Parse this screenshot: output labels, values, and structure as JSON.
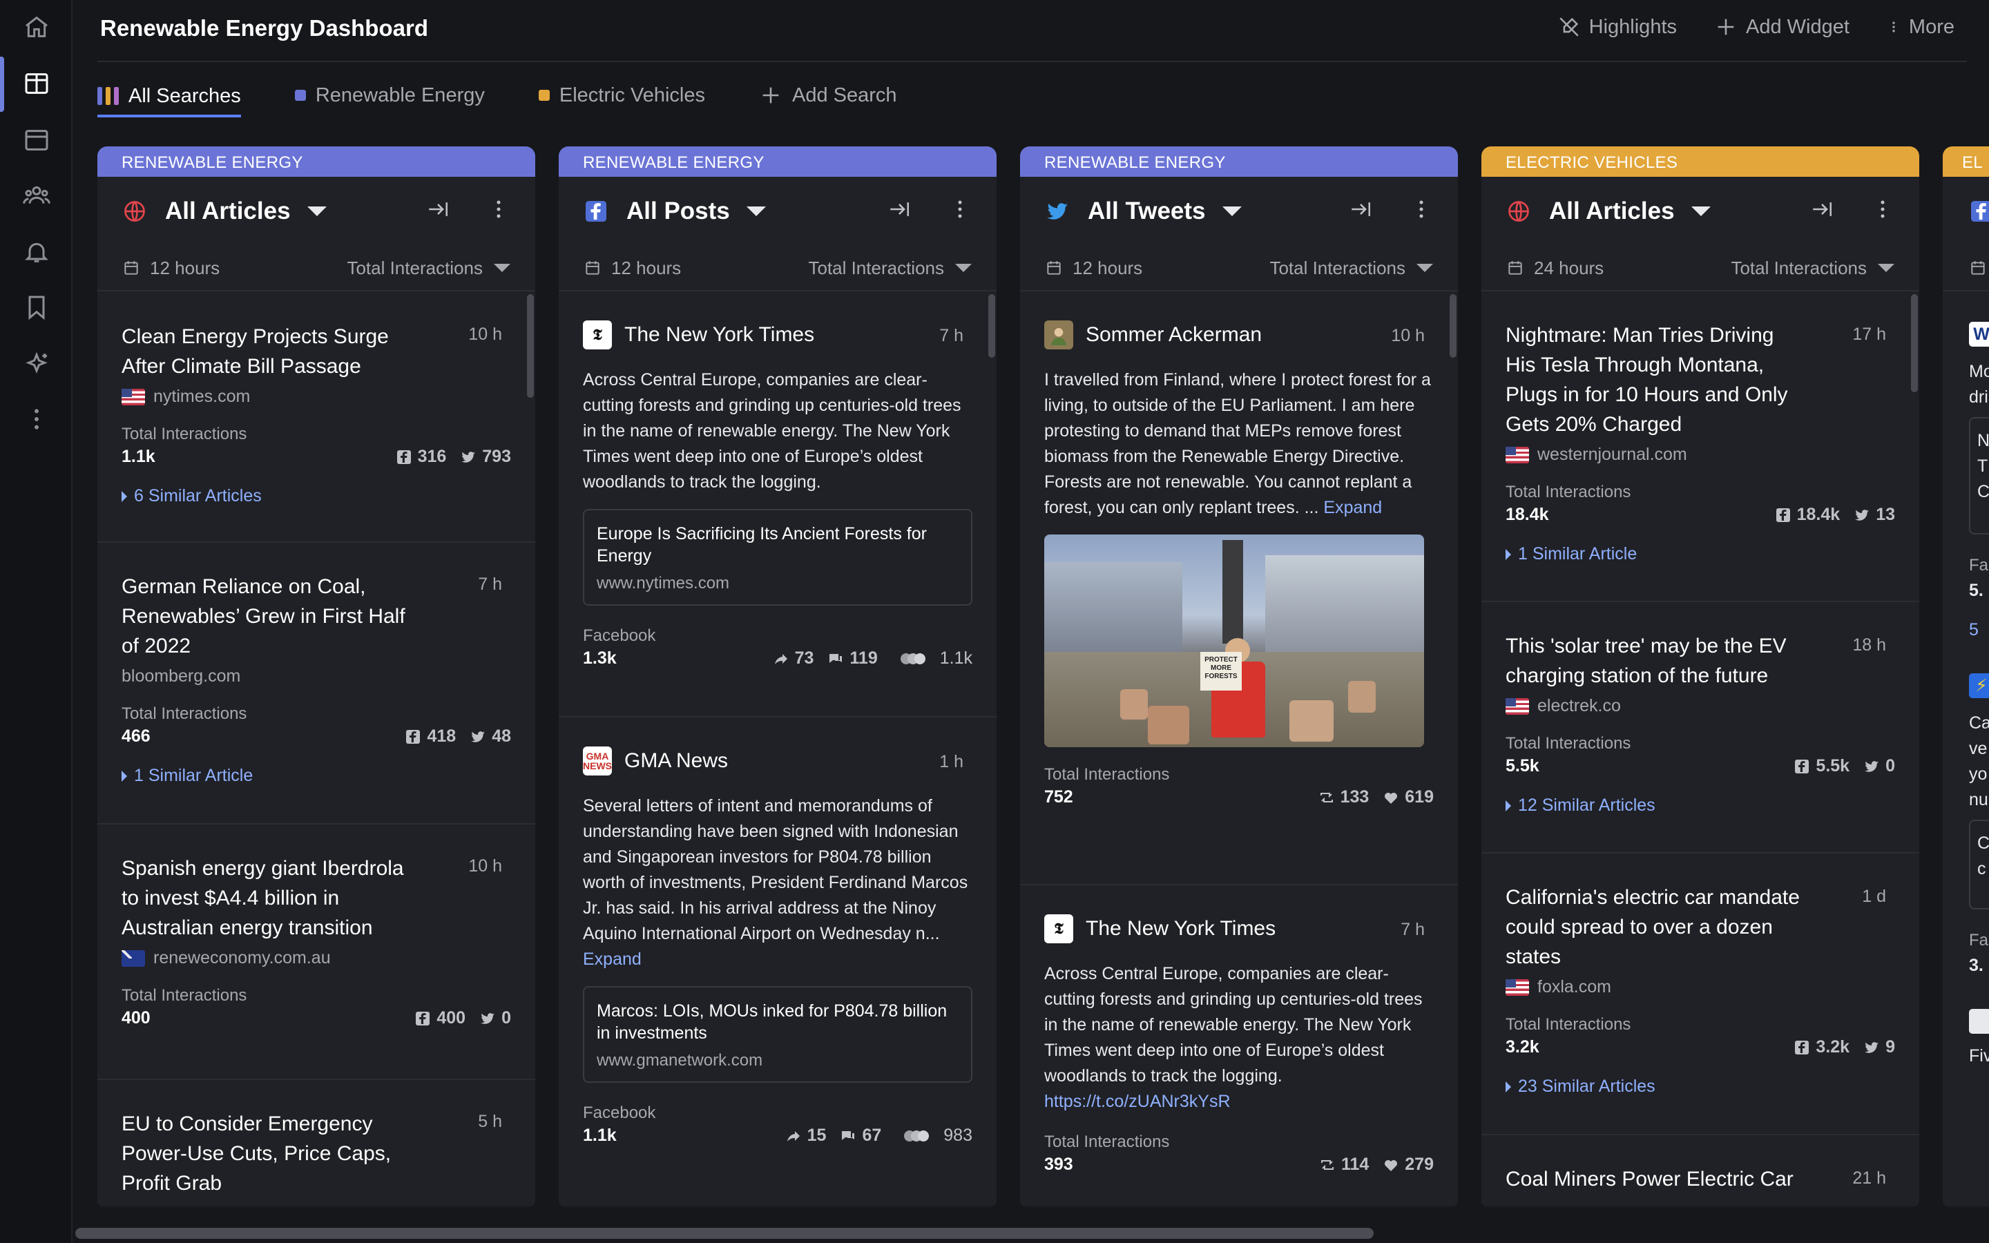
{
  "app_title": "Renewable Energy Dashboard",
  "top_actions": {
    "highlights": "Highlights",
    "add_widget": "Add Widget",
    "more": "More"
  },
  "tabs": {
    "all": "All Searches",
    "renewable": "Renewable Energy",
    "ev": "Electric Vehicles",
    "add": "Add Search"
  },
  "colors": {
    "renewable": "#6b74d6",
    "ev": "#e3a63a",
    "accent": "#5b7fff",
    "link": "#8fb0ff"
  },
  "columns": [
    {
      "label": "RENEWABLE ENERGY",
      "title": "All Articles",
      "icon": "globe-icon",
      "timeframe": "12 hours",
      "sort": "Total Interactions",
      "items": [
        {
          "title": "Clean Energy Projects Surge After Climate Bill Passage",
          "age": "10 h",
          "domain": "nytimes.com",
          "ti_label": "Total Interactions",
          "ti": "1.1k",
          "fb": "316",
          "tw": "793",
          "similar": "6 Similar Articles"
        },
        {
          "title": "German Reliance on Coal, Renewables’ Grew in First Half of 2022",
          "age": "7 h",
          "domain": "bloomberg.com",
          "ti_label": "Total Interactions",
          "ti": "466",
          "fb": "418",
          "tw": "48",
          "similar": "1 Similar Article"
        },
        {
          "title": "Spanish energy giant Iberdrola to invest $A4.4 billion in Australian energy transition",
          "age": "10 h",
          "domain": "reneweconomy.com.au",
          "ti_label": "Total Interactions",
          "ti": "400",
          "fb": "400",
          "tw": "0"
        },
        {
          "title": "EU to Consider Emergency Power-Use Cuts, Price Caps, Profit Grab",
          "age": "5 h"
        }
      ]
    },
    {
      "label": "RENEWABLE ENERGY",
      "title": "All Posts",
      "icon": "facebook-icon",
      "timeframe": "12 hours",
      "sort": "Total Interactions",
      "items": [
        {
          "source": "The New York Times",
          "age": "7 h",
          "text": "Across Central Europe, companies are clear-cutting forests and grinding up centuries-old trees in the name of renewable energy. The New York Times went deep into one of Europe’s oldest woodlands to track the logging.",
          "link_title": "Europe Is Sacrificing Its Ancient Forests for Energy",
          "link_url": "www.nytimes.com",
          "platform": "Facebook",
          "ti": "1.3k",
          "shares": "73",
          "comments": "119",
          "reactions": "1.1k"
        },
        {
          "source": "GMA News",
          "age": "1 h",
          "text": "Several letters of intent and memorandums of understanding have been signed with Indonesian and Singaporean investors for P804.78 billion worth of investments, President Ferdinand Marcos Jr. has said. In his arrival address at the Ninoy Aquino International Airport on Wednesday n...",
          "expand": "Expand",
          "link_title": "Marcos: LOIs, MOUs inked for P804.78 billion in investments",
          "link_url": "www.gmanetwork.com",
          "platform": "Facebook",
          "ti": "1.1k",
          "shares": "15",
          "comments": "67",
          "reactions": "983"
        }
      ]
    },
    {
      "label": "RENEWABLE ENERGY",
      "title": "All Tweets",
      "icon": "twitter-icon",
      "timeframe": "12 hours",
      "sort": "Total Interactions",
      "items": [
        {
          "source": "Sommer Ackerman",
          "age": "10 h",
          "text": "I travelled from Finland, where I protect forest for a living, to outside of the EU Parliament. I am here protesting to demand that MEPs remove forest biomass from the Renewable Energy Directive. Forests are not renewable. You cannot replant a forest, you can only replant trees. ...",
          "expand": "Expand",
          "sign": "PROTECT MORE FORESTS",
          "ti_label": "Total Interactions",
          "ti": "752",
          "retweets": "133",
          "likes": "619"
        },
        {
          "source": "The New York Times",
          "age": "7 h",
          "text": "Across Central Europe, companies are clear-cutting forests and grinding up centuries-old trees in the name of renewable energy. The New York Times went deep into one of Europe’s oldest woodlands to track the logging.",
          "url": "https://t.co/zUANr3kYsR",
          "ti_label": "Total Interactions",
          "ti": "393",
          "retweets": "114",
          "likes": "279"
        }
      ]
    },
    {
      "label": "ELECTRIC VEHICLES",
      "title": "All Articles",
      "icon": "globe-icon",
      "timeframe": "24 hours",
      "sort": "Total Interactions",
      "items": [
        {
          "title": "Nightmare: Man Tries Driving His Tesla Through Montana, Plugs in for 10 Hours and Only Gets 20% Charged",
          "age": "17 h",
          "domain": "westernjournal.com",
          "ti_label": "Total Interactions",
          "ti": "18.4k",
          "fb": "18.4k",
          "tw": "13",
          "similar": "1 Similar Article"
        },
        {
          "title": "This 'solar tree' may be the EV charging station of the future",
          "age": "18 h",
          "domain": "electrek.co",
          "ti_label": "Total Interactions",
          "ti": "5.5k",
          "fb": "5.5k",
          "tw": "0",
          "similar": "12 Similar Articles"
        },
        {
          "title": "California's electric car mandate could spread to over a dozen states",
          "age": "1 d",
          "domain": "foxla.com",
          "ti_label": "Total Interactions",
          "ti": "3.2k",
          "fb": "3.2k",
          "tw": "9",
          "similar": "23 Similar Articles"
        },
        {
          "title": "Coal Miners Power Electric Car",
          "age": "21 h"
        }
      ]
    },
    {
      "label": "EL",
      "snippets": [
        "Mo",
        "dri",
        "N",
        "T",
        "C",
        "Fa",
        "5.",
        "5",
        "Ca",
        "ve",
        "yo",
        "nu",
        "C",
        "c",
        "Fa",
        "3.",
        "Fiv"
      ]
    }
  ]
}
